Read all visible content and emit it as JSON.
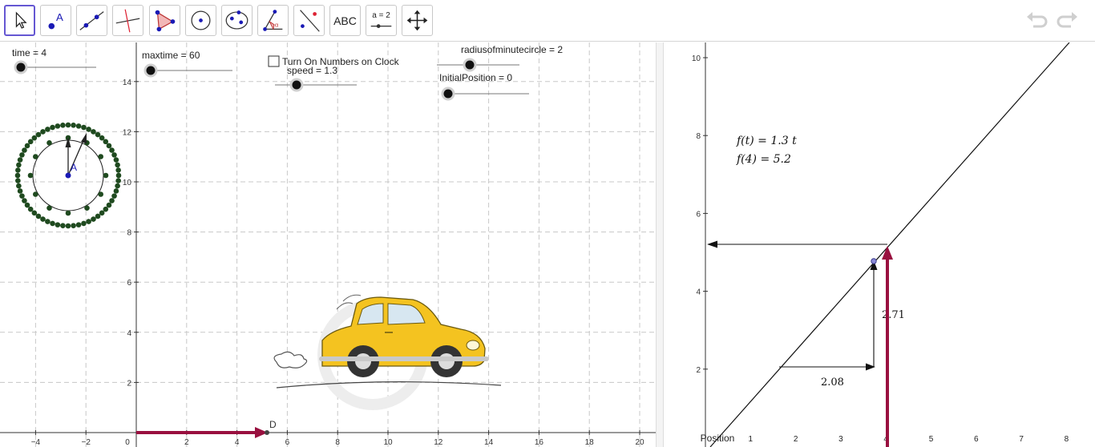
{
  "toolbar": {
    "tools": [
      {
        "name": "move-tool",
        "active": true
      },
      {
        "name": "point-tool"
      },
      {
        "name": "line-tool"
      },
      {
        "name": "perpendicular-line-tool"
      },
      {
        "name": "polygon-tool"
      },
      {
        "name": "circle-tool"
      },
      {
        "name": "ellipse-tool"
      },
      {
        "name": "angle-tool"
      },
      {
        "name": "reflect-tool"
      },
      {
        "name": "text-tool",
        "label": "ABC"
      },
      {
        "name": "slider-tool",
        "label": "a = 2"
      },
      {
        "name": "move-graphics-view-tool"
      }
    ],
    "undo_icon": "undo-icon",
    "redo_icon": "redo-icon"
  },
  "graphics1": {
    "sliders": {
      "time": "time = 4",
      "maxtime": "maxtime = 60",
      "speed": "speed = 1.3",
      "radius": "radiusofminutecircle = 2",
      "initial": "InitialPosition = 0"
    },
    "checkbox_label": "Turn On Numbers on Clock",
    "clock_center_label": "A",
    "point_label": "D",
    "x_ticks": [
      "−4",
      "−2",
      "0",
      "2",
      "4",
      "6",
      "8",
      "10",
      "12",
      "14",
      "16",
      "18",
      "20"
    ],
    "y_ticks": [
      "2",
      "4",
      "6",
      "8",
      "10",
      "12",
      "14"
    ],
    "image": "car-image",
    "accent_color": "#99103f"
  },
  "graphics2": {
    "function_text": "f(t) = 1.3 t",
    "value_text": "f(4) = 5.2",
    "x_ticks": [
      "Position",
      "1",
      "2",
      "3",
      "4",
      "5",
      "6",
      "7",
      "8"
    ],
    "y_ticks": [
      "2",
      "4",
      "6",
      "8",
      "10"
    ],
    "slope_run": "2.08",
    "slope_rise": "2.71"
  }
}
